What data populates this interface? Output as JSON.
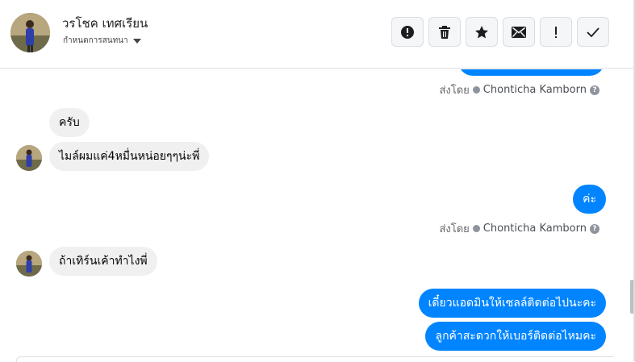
{
  "header": {
    "contact_name": "วรโชค เทศเรียน",
    "subtitle": "กำหนดการสนทนา",
    "actions": [
      {
        "id": "report",
        "icon": "alert-circle-icon"
      },
      {
        "id": "delete",
        "icon": "trash-icon"
      },
      {
        "id": "star",
        "icon": "star-icon"
      },
      {
        "id": "unread",
        "icon": "envelope-icon"
      },
      {
        "id": "important",
        "icon": "exclamation-icon"
      },
      {
        "id": "done",
        "icon": "check-icon"
      }
    ]
  },
  "messages": {
    "sent_by_1": {
      "prefix": "ส่งโดย",
      "name": "Chonticha Kamborn"
    },
    "in_1": "ครับ",
    "in_2": "ไมล์ผมแค่4หมื่นหน่อยๆๆน่ะพี่",
    "out_1": "ค่ะ",
    "sent_by_2": {
      "prefix": "ส่งโดย",
      "name": "Chonticha Kamborn"
    },
    "in_3": "ถ้าเทิร์นเค้าทำไงพี่",
    "out_2": "เดี๋ยวแอดมินให้เซลล์ติดต่อไปนะคะ",
    "out_3": "ลูกค้าสะดวกให้เบอร์ติดต่อไหมคะ"
  },
  "colors": {
    "outgoing_bubble": "#0084ff",
    "incoming_bubble": "#f0f0f0",
    "secondary_text": "#65676b"
  }
}
